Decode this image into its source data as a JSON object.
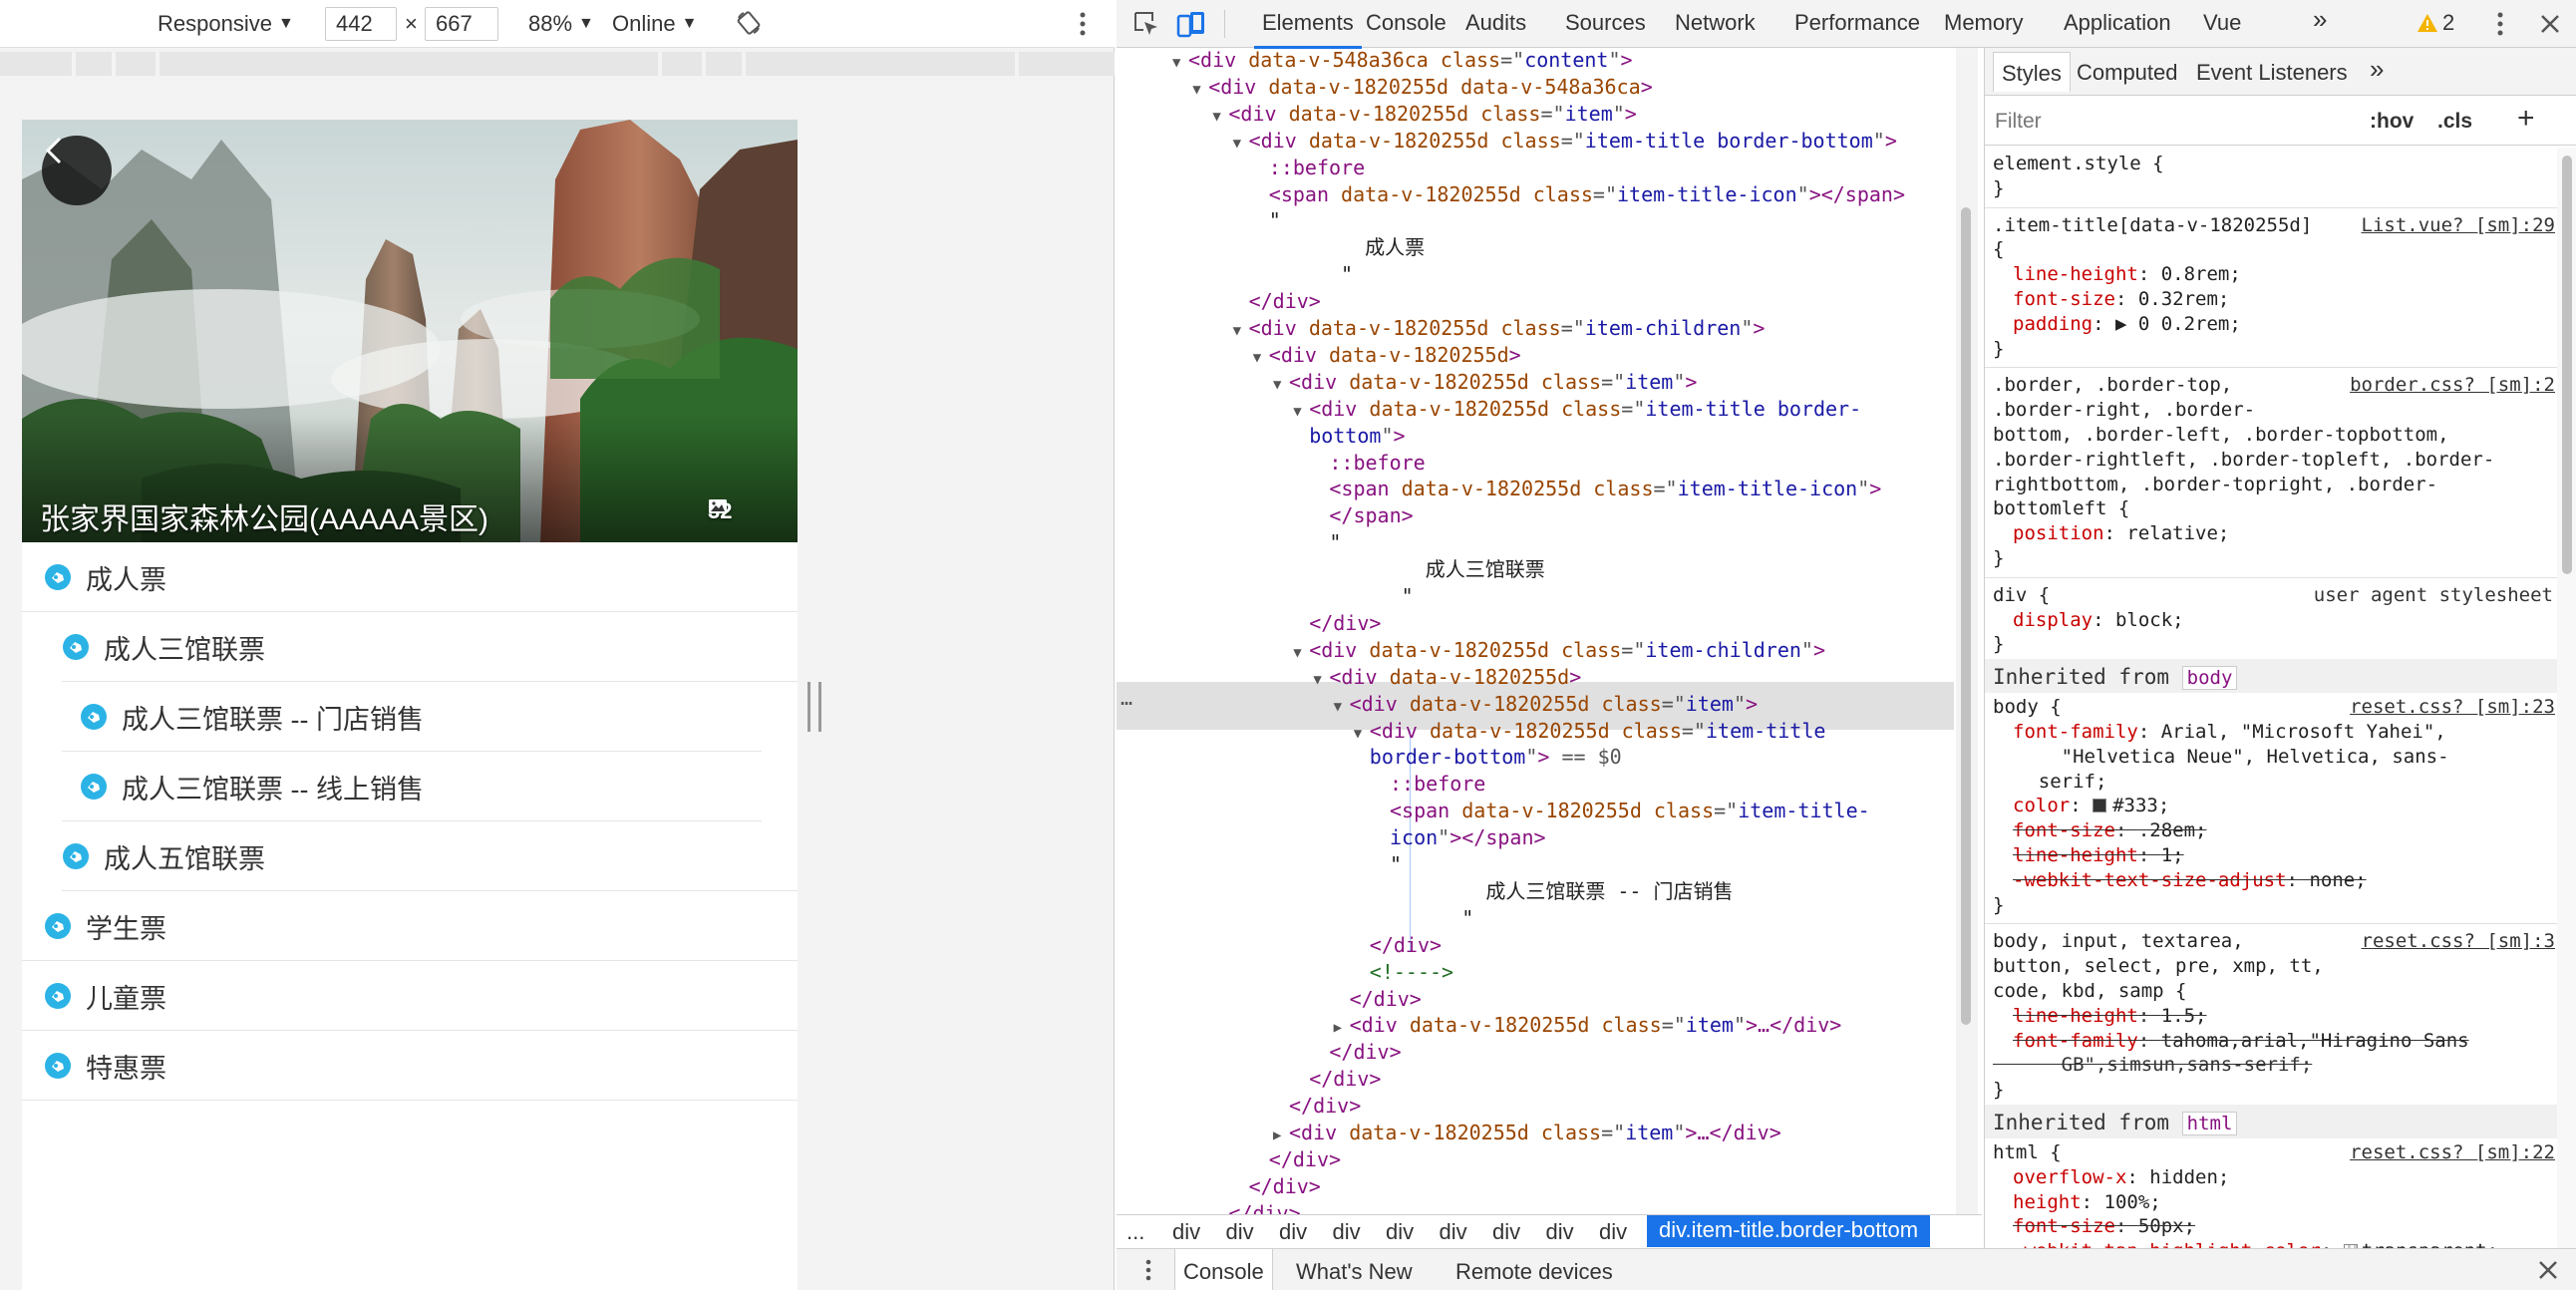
{
  "device_toolbar": {
    "mode": "Responsive",
    "width": "442",
    "times": "×",
    "height": "667",
    "zoom": "88%",
    "network": "Online"
  },
  "device_page": {
    "hero_title": "张家界国家森林公园(AAAAA景区)",
    "photo_count": "32",
    "ticket_items": [
      {
        "label": "成人票",
        "level": 0
      },
      {
        "label": "成人三馆联票",
        "level": 1
      },
      {
        "label": "成人三馆联票 -- 门店销售",
        "level": 2
      },
      {
        "label": "成人三馆联票 -- 线上销售",
        "level": 2
      },
      {
        "label": "成人五馆联票",
        "level": 1
      },
      {
        "label": "学生票",
        "level": 0
      },
      {
        "label": "儿童票",
        "level": 0
      },
      {
        "label": "特惠票",
        "level": 0
      }
    ],
    "icon_color": "#2bb3e6"
  },
  "devtools": {
    "tabs": [
      "Elements",
      "Console",
      "Audits",
      "Sources",
      "Network",
      "Performance",
      "Memory",
      "Application",
      "Vue"
    ],
    "more": "»",
    "warning_count": "2",
    "accent": "#1a73e8"
  },
  "dom_lines": [
    {
      "d": 0,
      "t": "▼",
      "parts": [
        [
          "tg",
          "<div "
        ],
        [
          "at",
          "data-v-548a36ca "
        ],
        [
          "at",
          "class"
        ],
        [
          "eq",
          "=\""
        ],
        [
          "av",
          "content"
        ],
        [
          "eq",
          "\""
        ],
        [
          "tg",
          ">"
        ]
      ]
    },
    {
      "d": 1,
      "t": "▼",
      "parts": [
        [
          "tg",
          "<div "
        ],
        [
          "at",
          "data-v-1820255d data-v-548a36ca"
        ],
        [
          "tg",
          ">"
        ]
      ]
    },
    {
      "d": 2,
      "t": "▼",
      "parts": [
        [
          "tg",
          "<div "
        ],
        [
          "at",
          "data-v-1820255d "
        ],
        [
          "at",
          "class"
        ],
        [
          "eq",
          "=\""
        ],
        [
          "av",
          "item"
        ],
        [
          "eq",
          "\""
        ],
        [
          "tg",
          ">"
        ]
      ]
    },
    {
      "d": 3,
      "t": "▼",
      "parts": [
        [
          "tg",
          "<div "
        ],
        [
          "at",
          "data-v-1820255d "
        ],
        [
          "at",
          "class"
        ],
        [
          "eq",
          "=\""
        ],
        [
          "av",
          "item-title border-bottom"
        ],
        [
          "eq",
          "\""
        ],
        [
          "tg",
          ">"
        ]
      ]
    },
    {
      "d": 4,
      "t": "",
      "parts": [
        [
          "ps",
          "::before"
        ]
      ]
    },
    {
      "d": 4,
      "t": "",
      "parts": [
        [
          "tg",
          "<span "
        ],
        [
          "at",
          "data-v-1820255d "
        ],
        [
          "at",
          "class"
        ],
        [
          "eq",
          "=\""
        ],
        [
          "av",
          "item-title-icon"
        ],
        [
          "eq",
          "\""
        ],
        [
          "tg",
          "></span>"
        ]
      ]
    },
    {
      "d": 4,
      "t": "",
      "parts": [
        [
          "tx",
          "\""
        ]
      ]
    },
    {
      "d": 4,
      "t": "",
      "parts": [
        [
          "tx",
          "        成人票"
        ]
      ]
    },
    {
      "d": 4,
      "t": "",
      "parts": [
        [
          "tx",
          "      \""
        ]
      ]
    },
    {
      "d": 3,
      "t": "",
      "parts": [
        [
          "tg",
          "</div>"
        ]
      ]
    },
    {
      "d": 3,
      "t": "▼",
      "parts": [
        [
          "tg",
          "<div "
        ],
        [
          "at",
          "data-v-1820255d "
        ],
        [
          "at",
          "class"
        ],
        [
          "eq",
          "=\""
        ],
        [
          "av",
          "item-children"
        ],
        [
          "eq",
          "\""
        ],
        [
          "tg",
          ">"
        ]
      ]
    },
    {
      "d": 4,
      "t": "▼",
      "parts": [
        [
          "tg",
          "<div "
        ],
        [
          "at",
          "data-v-1820255d"
        ],
        [
          "tg",
          ">"
        ]
      ]
    },
    {
      "d": 5,
      "t": "▼",
      "parts": [
        [
          "tg",
          "<div "
        ],
        [
          "at",
          "data-v-1820255d "
        ],
        [
          "at",
          "class"
        ],
        [
          "eq",
          "=\""
        ],
        [
          "av",
          "item"
        ],
        [
          "eq",
          "\""
        ],
        [
          "tg",
          ">"
        ]
      ]
    },
    {
      "d": 6,
      "t": "▼",
      "parts": [
        [
          "tg",
          "<div "
        ],
        [
          "at",
          "data-v-1820255d "
        ],
        [
          "at",
          "class"
        ],
        [
          "eq",
          "=\""
        ],
        [
          "av",
          "item-title border-"
        ],
        [
          "eq",
          ""
        ]
      ]
    },
    {
      "d": 6,
      "t": "",
      "parts": [
        [
          "av",
          "bottom"
        ],
        [
          "eq",
          "\""
        ],
        [
          "tg",
          ">"
        ]
      ]
    },
    {
      "d": 7,
      "t": "",
      "parts": [
        [
          "ps",
          "::before"
        ]
      ]
    },
    {
      "d": 7,
      "t": "",
      "parts": [
        [
          "tg",
          "<span "
        ],
        [
          "at",
          "data-v-1820255d "
        ],
        [
          "at",
          "class"
        ],
        [
          "eq",
          "=\""
        ],
        [
          "av",
          "item-title-icon"
        ],
        [
          "eq",
          "\""
        ],
        [
          "tg",
          ">"
        ]
      ]
    },
    {
      "d": 7,
      "t": "",
      "parts": [
        [
          "tg",
          "</span>"
        ]
      ]
    },
    {
      "d": 7,
      "t": "",
      "parts": [
        [
          "tx",
          "\""
        ]
      ]
    },
    {
      "d": 7,
      "t": "",
      "parts": [
        [
          "tx",
          "        成人三馆联票"
        ]
      ]
    },
    {
      "d": 7,
      "t": "",
      "parts": [
        [
          "tx",
          "      \""
        ]
      ]
    },
    {
      "d": 6,
      "t": "",
      "parts": [
        [
          "tg",
          "</div>"
        ]
      ]
    },
    {
      "d": 6,
      "t": "▼",
      "parts": [
        [
          "tg",
          "<div "
        ],
        [
          "at",
          "data-v-1820255d "
        ],
        [
          "at",
          "class"
        ],
        [
          "eq",
          "=\""
        ],
        [
          "av",
          "item-children"
        ],
        [
          "eq",
          "\""
        ],
        [
          "tg",
          ">"
        ]
      ]
    },
    {
      "d": 7,
      "t": "▼",
      "parts": [
        [
          "tg",
          "<div "
        ],
        [
          "at",
          "data-v-1820255d"
        ],
        [
          "tg",
          ">"
        ]
      ]
    },
    {
      "d": 8,
      "t": "▼",
      "parts": [
        [
          "tg",
          "<div "
        ],
        [
          "at",
          "data-v-1820255d "
        ],
        [
          "at",
          "class"
        ],
        [
          "eq",
          "=\""
        ],
        [
          "av",
          "item"
        ],
        [
          "eq",
          "\""
        ],
        [
          "tg",
          ">"
        ]
      ]
    },
    {
      "d": 9,
      "t": "▼",
      "parts": [
        [
          "tg",
          "<div "
        ],
        [
          "at",
          "data-v-1820255d "
        ],
        [
          "at",
          "class"
        ],
        [
          "eq",
          "=\""
        ],
        [
          "av",
          "item-title"
        ],
        [
          "eq",
          ""
        ]
      ]
    },
    {
      "d": 9,
      "t": "",
      "parts": [
        [
          "av",
          "border-bottom"
        ],
        [
          "eq",
          "\""
        ],
        [
          "tg",
          ">"
        ],
        [
          "eq",
          " == $0"
        ]
      ]
    },
    {
      "d": 10,
      "t": "",
      "parts": [
        [
          "ps",
          "::before"
        ]
      ]
    },
    {
      "d": 10,
      "t": "",
      "parts": [
        [
          "tg",
          "<span "
        ],
        [
          "at",
          "data-v-1820255d "
        ],
        [
          "at",
          "class"
        ],
        [
          "eq",
          "=\""
        ],
        [
          "av",
          "item-title-"
        ],
        [
          "eq",
          ""
        ]
      ]
    },
    {
      "d": 10,
      "t": "",
      "parts": [
        [
          "av",
          "icon"
        ],
        [
          "eq",
          "\""
        ],
        [
          "tg",
          "></span>"
        ]
      ]
    },
    {
      "d": 10,
      "t": "",
      "parts": [
        [
          "tx",
          "\""
        ]
      ]
    },
    {
      "d": 10,
      "t": "",
      "parts": [
        [
          "tx",
          "        成人三馆联票 -- 门店销售"
        ]
      ]
    },
    {
      "d": 10,
      "t": "",
      "parts": [
        [
          "tx",
          "      \""
        ]
      ]
    },
    {
      "d": 9,
      "t": "",
      "parts": [
        [
          "tg",
          "</div>"
        ]
      ]
    },
    {
      "d": 9,
      "t": "",
      "parts": [
        [
          "cm",
          "<!---->"
        ]
      ]
    },
    {
      "d": 8,
      "t": "",
      "parts": [
        [
          "tg",
          "</div>"
        ]
      ]
    },
    {
      "d": 8,
      "t": "▶",
      "parts": [
        [
          "tg",
          "<div "
        ],
        [
          "at",
          "data-v-1820255d "
        ],
        [
          "at",
          "class"
        ],
        [
          "eq",
          "=\""
        ],
        [
          "av",
          "item"
        ],
        [
          "eq",
          "\""
        ],
        [
          "tg",
          ">…</div>"
        ]
      ]
    },
    {
      "d": 7,
      "t": "",
      "parts": [
        [
          "tg",
          "</div>"
        ]
      ]
    },
    {
      "d": 6,
      "t": "",
      "parts": [
        [
          "tg",
          "</div>"
        ]
      ]
    },
    {
      "d": 5,
      "t": "",
      "parts": [
        [
          "tg",
          "</div>"
        ]
      ]
    },
    {
      "d": 5,
      "t": "▶",
      "parts": [
        [
          "tg",
          "<div "
        ],
        [
          "at",
          "data-v-1820255d "
        ],
        [
          "at",
          "class"
        ],
        [
          "eq",
          "=\""
        ],
        [
          "av",
          "item"
        ],
        [
          "eq",
          "\""
        ],
        [
          "tg",
          ">…</div>"
        ]
      ]
    },
    {
      "d": 4,
      "t": "",
      "parts": [
        [
          "tg",
          "</div>"
        ]
      ]
    },
    {
      "d": 3,
      "t": "",
      "parts": [
        [
          "tg",
          "</div>"
        ]
      ]
    },
    {
      "d": 2,
      "t": "",
      "parts": [
        [
          "tg",
          "</div>"
        ]
      ]
    },
    {
      "d": 2,
      "t": "▶",
      "parts": [
        [
          "tg",
          "<div "
        ],
        [
          "at",
          "data-v-1820255d "
        ],
        [
          "at",
          "class"
        ],
        [
          "eq",
          "=\""
        ],
        [
          "av",
          "item"
        ],
        [
          "eq",
          "\""
        ],
        [
          "tg",
          ">…</div>"
        ]
      ]
    },
    {
      "d": 2,
      "t": "▶",
      "parts": [
        [
          "tg",
          "<div "
        ],
        [
          "at",
          "data-v-1820255d "
        ],
        [
          "at",
          "class"
        ],
        [
          "eq",
          "=\""
        ],
        [
          "av",
          "item"
        ],
        [
          "eq",
          "\""
        ],
        [
          "tg",
          ">…</div>"
        ]
      ]
    }
  ],
  "breadcrumbs": {
    "ellipsis": "...",
    "items": [
      "div",
      "div",
      "div",
      "div",
      "div",
      "div",
      "div",
      "div",
      "div"
    ],
    "current": "div.item-title.border-bottom"
  },
  "styles_panel": {
    "tabs": [
      "Styles",
      "Computed",
      "Event Listeners",
      "»"
    ],
    "filter_placeholder": "Filter",
    "hov": ":hov",
    "cls": ".cls",
    "plus": "+",
    "inherited_body": "Inherited from",
    "chip_body": "body",
    "chip_html": "html",
    "lines": [
      {
        "k": "plain",
        "text": "element.style {"
      },
      {
        "k": "plain",
        "text": "}"
      },
      {
        "k": "sep"
      },
      {
        "k": "sel",
        "text": ".item-title[data-v-1820255d]",
        "src": "List.vue? [sm]:29"
      },
      {
        "k": "plain",
        "text": "{"
      },
      {
        "k": "prop",
        "pn": "line-height",
        "pv": "0.8rem;"
      },
      {
        "k": "prop",
        "pn": "font-size",
        "pv": "0.32rem;"
      },
      {
        "k": "prop",
        "pn": "padding",
        "pv": "▶ 0 0.2rem;"
      },
      {
        "k": "plain",
        "text": "}"
      },
      {
        "k": "sep"
      },
      {
        "k": "sel",
        "text": ".border, .border-top,",
        "src": "border.css? [sm]:2"
      },
      {
        "k": "plain",
        "text": ".border-right, .border-"
      },
      {
        "k": "plain",
        "text": "bottom, .border-left, .border-topbottom,"
      },
      {
        "k": "plain",
        "text": ".border-rightleft, .border-topleft, .border-"
      },
      {
        "k": "plain",
        "text": "rightbottom, .border-topright, .border-"
      },
      {
        "k": "plain",
        "text": "bottomleft {"
      },
      {
        "k": "prop",
        "pn": "position",
        "pv": "relative;"
      },
      {
        "k": "plain",
        "text": "}"
      },
      {
        "k": "sep"
      },
      {
        "k": "sel",
        "text": "div {",
        "ua": "user agent stylesheet"
      },
      {
        "k": "prop",
        "pn": "display",
        "pv": "block;"
      },
      {
        "k": "plain",
        "text": "}"
      },
      {
        "k": "inh",
        "chip": "body"
      },
      {
        "k": "sel",
        "text": "body {",
        "src": "reset.css? [sm]:23"
      },
      {
        "k": "prop",
        "pn": "font-family",
        "pv": "Arial, \"Microsoft Yahei\","
      },
      {
        "k": "plain",
        "text": "      \"Helvetica Neue\", Helvetica, sans-"
      },
      {
        "k": "plain",
        "text": "    serif;"
      },
      {
        "k": "color",
        "pn": "color",
        "pv": "#333;"
      },
      {
        "k": "strike",
        "pn": "font-size",
        "pv": ".28em;"
      },
      {
        "k": "strike",
        "pn": "line-height",
        "pv": "1;"
      },
      {
        "k": "strike",
        "pn": "-webkit-text-size-adjust",
        "pv": "none;"
      },
      {
        "k": "plain",
        "text": "}"
      },
      {
        "k": "sep"
      },
      {
        "k": "sel",
        "text": "body, input, textarea,",
        "src": "reset.css? [sm]:3"
      },
      {
        "k": "plain",
        "text": "button, select, pre, xmp, tt,"
      },
      {
        "k": "plain",
        "text": "code, kbd, samp {"
      },
      {
        "k": "strike",
        "pn": "line-height",
        "pv": "1.5;"
      },
      {
        "k": "strike",
        "pn": "font-family",
        "pv": "tahoma,arial,\"Hiragino Sans"
      },
      {
        "k": "strikecont",
        "text": "      GB\",simsun,sans-serif;"
      },
      {
        "k": "plain",
        "text": "}"
      },
      {
        "k": "inh",
        "chip": "html"
      },
      {
        "k": "sel",
        "text": "html {",
        "src": "reset.css? [sm]:22"
      },
      {
        "k": "prop",
        "pn": "overflow-x",
        "pv": "hidden;"
      },
      {
        "k": "prop",
        "pn": "height",
        "pv": "100%;"
      },
      {
        "k": "strike",
        "pn": "font-size",
        "pv": "50px;"
      },
      {
        "k": "prop",
        "pn": "-webkit-tap-highlight-color",
        "pv": "transparent;",
        "swatch": true
      }
    ]
  },
  "drawer": {
    "tabs": [
      "Console",
      "What's New",
      "Remote devices"
    ]
  }
}
